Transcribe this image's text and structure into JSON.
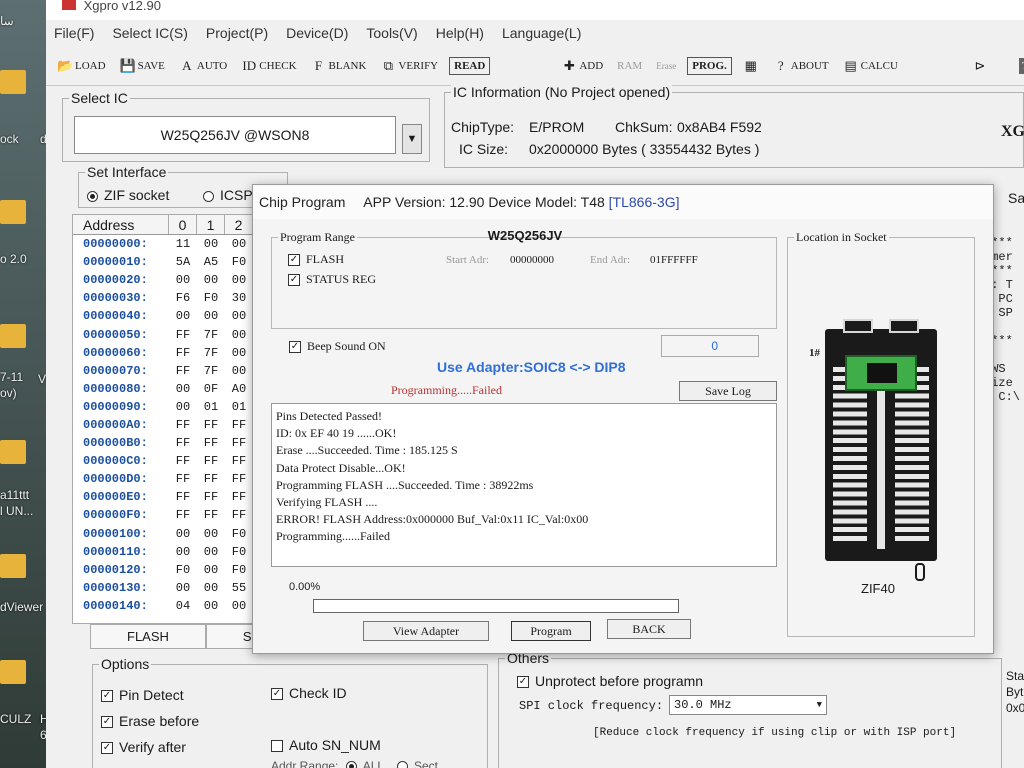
{
  "desktop": {
    "labels": [
      "ﺳﺎ",
      "ock",
      "d",
      "o 2.0",
      "7-11",
      "ov)",
      "V",
      "a11ttt",
      "l UN...",
      "dViewer",
      "CULZ",
      "H",
      "64"
    ]
  },
  "app": {
    "title": "Xgpro v12.90",
    "menu": [
      "File(F)",
      "Select IC(S)",
      "Project(P)",
      "Device(D)",
      "Tools(V)",
      "Help(H)",
      "Language(L)"
    ],
    "toolbar": {
      "load": "LOAD",
      "save": "SAVE",
      "auto": "AUTO",
      "check": "CHECK",
      "blank": "BLANK",
      "verify": "VERIFY",
      "read": "READ",
      "add": "ADD",
      "ram": "RAM",
      "erase": "Erase",
      "prog": "PROG.",
      "about": "ABOUT",
      "calcu": "CALCU",
      "tv": "TV"
    },
    "select_ic": {
      "title": "Select IC",
      "value": "W25Q256JV @WSON8",
      "dropdown_glyph": "▼"
    },
    "ic_info": {
      "title": "IC Information (No Project opened)",
      "chip_type_label": "ChipType:",
      "chip_type": "E/PROM",
      "chksum_label": "ChkSum:",
      "chksum": "0x8AB4 F592",
      "size_label": "IC Size:",
      "size": "0x2000000 Bytes ( 33554432 Bytes )",
      "right_text": "XG"
    },
    "set_interface": {
      "title": "Set Interface",
      "zif": "ZIF socket",
      "icsp": "ICSP"
    },
    "hex_table": {
      "headers": [
        "Address",
        "0",
        "1",
        "2"
      ],
      "rows": [
        {
          "addr": "00000000:",
          "b": [
            "11",
            "00",
            "00"
          ]
        },
        {
          "addr": "00000010:",
          "b": [
            "5A",
            "A5",
            "F0"
          ]
        },
        {
          "addr": "00000020:",
          "b": [
            "00",
            "00",
            "00"
          ]
        },
        {
          "addr": "00000030:",
          "b": [
            "F6",
            "F0",
            "30"
          ]
        },
        {
          "addr": "00000040:",
          "b": [
            "00",
            "00",
            "00"
          ]
        },
        {
          "addr": "00000050:",
          "b": [
            "FF",
            "7F",
            "00"
          ]
        },
        {
          "addr": "00000060:",
          "b": [
            "FF",
            "7F",
            "00"
          ]
        },
        {
          "addr": "00000070:",
          "b": [
            "FF",
            "7F",
            "00"
          ]
        },
        {
          "addr": "00000080:",
          "b": [
            "00",
            "0F",
            "A0"
          ]
        },
        {
          "addr": "00000090:",
          "b": [
            "00",
            "01",
            "01"
          ]
        },
        {
          "addr": "000000A0:",
          "b": [
            "FF",
            "FF",
            "FF"
          ]
        },
        {
          "addr": "000000B0:",
          "b": [
            "FF",
            "FF",
            "FF"
          ]
        },
        {
          "addr": "000000C0:",
          "b": [
            "FF",
            "FF",
            "FF"
          ]
        },
        {
          "addr": "000000D0:",
          "b": [
            "FF",
            "FF",
            "FF"
          ]
        },
        {
          "addr": "000000E0:",
          "b": [
            "FF",
            "FF",
            "FF"
          ]
        },
        {
          "addr": "000000F0:",
          "b": [
            "FF",
            "FF",
            "FF"
          ]
        },
        {
          "addr": "00000100:",
          "b": [
            "00",
            "00",
            "F0"
          ]
        },
        {
          "addr": "00000110:",
          "b": [
            "00",
            "00",
            "F0"
          ]
        },
        {
          "addr": "00000120:",
          "b": [
            "F0",
            "00",
            "F0"
          ]
        },
        {
          "addr": "00000130:",
          "b": [
            "00",
            "00",
            "55"
          ]
        },
        {
          "addr": "00000140:",
          "b": [
            "04",
            "00",
            "00"
          ]
        }
      ]
    },
    "bottom_tabs": [
      "FLASH",
      "STATU"
    ],
    "options": {
      "title": "Options",
      "pin_detect": "Pin Detect",
      "check_id": "Check ID",
      "erase_before": "Erase before",
      "verify_after": "Verify after",
      "auto_sn": "Auto SN_NUM",
      "addr_range": "Addr Range:",
      "all": "ALL",
      "sect": "Sect"
    },
    "others": {
      "title": "Others",
      "unprotect": "Unprotect before programn",
      "spi_label": "SPI clock frequency:",
      "spi_value": "30.0 MHz",
      "note": "[Reduce clock frequency if using clip or with ISP port]"
    },
    "right_console": [
      "****",
      "mmer",
      "****",
      "1: T",
      "B PC",
      "B SP",
      "****",
      "@WS",
      "Size",
      ": C:\\"
    ],
    "right_side": [
      "Sa",
      "Sta",
      "Byt",
      "0x0"
    ]
  },
  "dialog": {
    "title": "Chip Program",
    "version": "APP Version: 12.90 Device Model: T48",
    "model": "[TL866-3G]",
    "chip_name": "W25Q256JV",
    "program_range": {
      "legend": "Program Range",
      "flash": "FLASH",
      "status_reg": "STATUS REG",
      "start_label": "Start Adr:",
      "start": "00000000",
      "end_label": "End Adr:",
      "end": "01FFFFFF"
    },
    "beep": "Beep Sound ON",
    "counter": "0",
    "adapter": "Use Adapter:SOIC8 <-> DIP8",
    "status_tab": "Programming.....Failed",
    "save_log": "Save Log",
    "log": [
      "Pins Detected Passed!",
      "ID: 0x EF 40 19 ......OK!",
      "Erase ....Succeeded. Time : 185.125 S",
      "Data Protect Disable...OK!",
      "Programming FLASH ....Succeeded. Time : 38922ms",
      "Verifying FLASH ....",
      "ERROR!  FLASH Address:0x000000   Buf_Val:0x11   IC_Val:0x00",
      "Programming......Failed"
    ],
    "progress_text": "0.00%",
    "progress_value": 0,
    "buttons": {
      "view_adapter": "View Adapter",
      "program": "Program",
      "back": "BACK"
    },
    "location": {
      "legend": "Location in Socket",
      "pin1": "1#",
      "socket": "ZIF40"
    }
  }
}
